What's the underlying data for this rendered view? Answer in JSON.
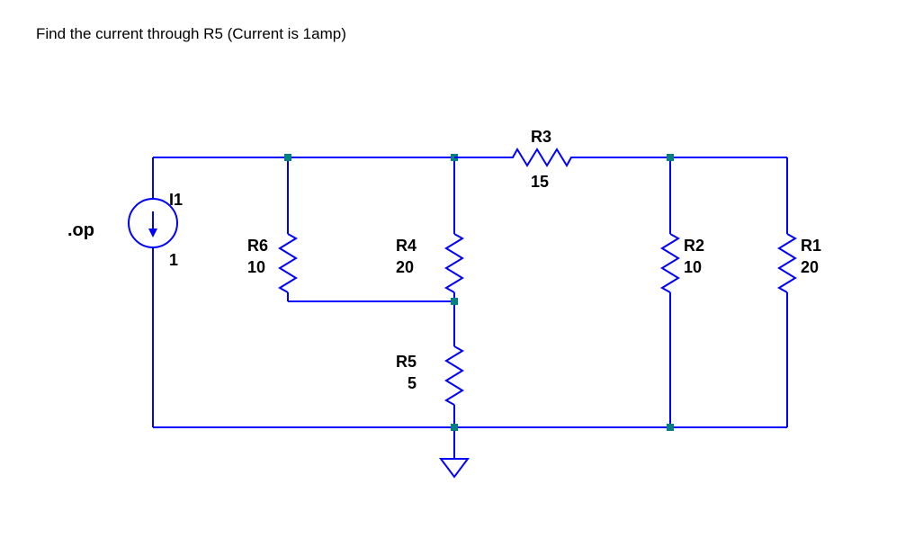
{
  "question": "Find the current through R5 (Current is 1amp)",
  "directive": ".op",
  "components": {
    "I1": {
      "label": "I1",
      "value": "1"
    },
    "R6": {
      "label": "R6",
      "value": "10"
    },
    "R4": {
      "label": "R4",
      "value": "20"
    },
    "R5": {
      "label": "R5",
      "value": "5"
    },
    "R3": {
      "label": "R3",
      "value": "15"
    },
    "R2": {
      "label": "R2",
      "value": "10"
    },
    "R1": {
      "label": "R1",
      "value": "20"
    }
  },
  "colors": {
    "wire": "#0000ff",
    "node": "#008080",
    "ground": "#0000ff"
  }
}
